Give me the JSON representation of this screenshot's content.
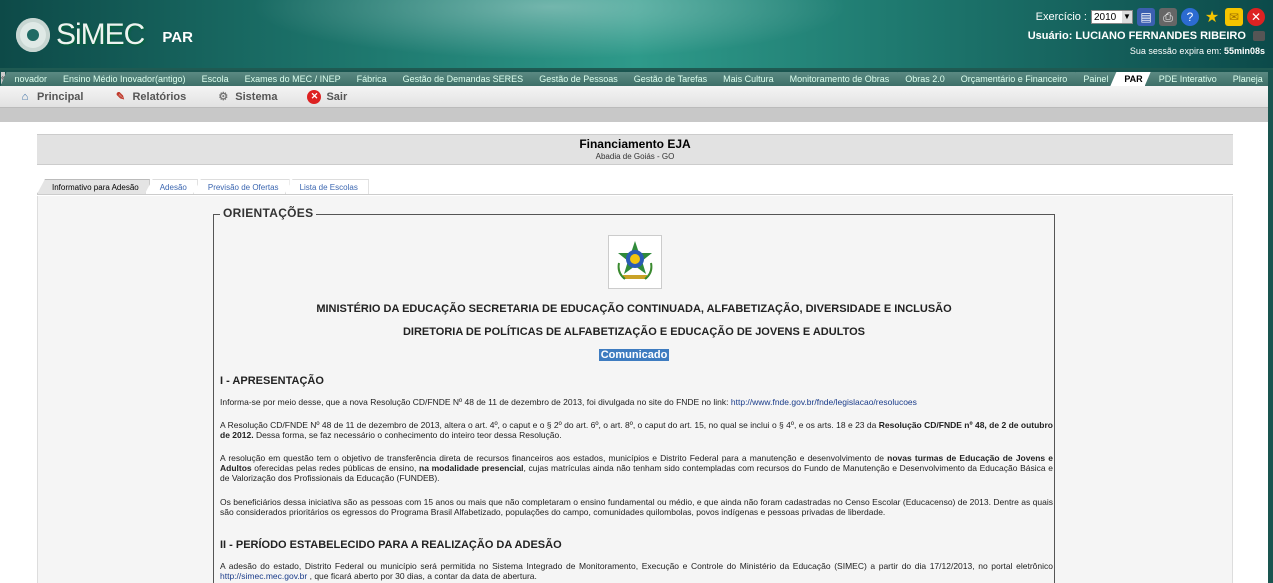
{
  "header": {
    "brand": "SiMEC",
    "module": "PAR",
    "exercise_label": "Exercício :",
    "exercise_year": "2010",
    "user_label": "Usuário:",
    "user_name": "LUCIANO FERNANDES RIBEIRO",
    "session_text": "Sua sessão expira em:",
    "session_time": "55min08s",
    "icons": [
      "chart-icon",
      "printer-icon",
      "help-icon",
      "star-icon",
      "mail-icon",
      "close-icon"
    ]
  },
  "module_tabs": {
    "items": [
      "novador",
      "Ensino Médio Inovador(antigo)",
      "Escola",
      "Exames do MEC / INEP",
      "Fábrica",
      "Gestão de Demandas SERES",
      "Gestão de Pessoas",
      "Gestão de Tarefas",
      "Mais Cultura",
      "Monitoramento de Obras",
      "Obras 2.0",
      "Orçamentário e Financeiro",
      "Painel",
      "PAR",
      "PDE Interativo",
      "Planeja"
    ],
    "active": "PAR"
  },
  "menu": {
    "items": [
      {
        "label": "Principal",
        "icon": "home-icon"
      },
      {
        "label": "Relatórios",
        "icon": "report-icon"
      },
      {
        "label": "Sistema",
        "icon": "settings-icon"
      },
      {
        "label": "Sair",
        "icon": "exit-icon"
      }
    ]
  },
  "page": {
    "title": "Financiamento EJA",
    "subtitle": "Abadia de Goiás - GO"
  },
  "tabs": [
    "Informativo para Adesão",
    "Adesão",
    "Previsão de Ofertas",
    "Lista de Escolas"
  ],
  "orientacoes": {
    "legend": "ORIENTAÇÕES",
    "heading1": "MINISTÉRIO DA EDUCAÇÃO SECRETARIA DE EDUCAÇÃO CONTINUADA, ALFABETIZAÇÃO, DIVERSIDADE E INCLUSÃO",
    "heading2": "DIRETORIA DE POLÍTICAS DE ALFABETIZAÇÃO E EDUCAÇÃO DE JOVENS E ADULTOS",
    "comunicado": "Comunicado",
    "section1_title": "I - APRESENTAÇÃO",
    "p1_text": "Informa-se por meio desse, que a nova Resolução CD/FNDE Nº 48 de 11 de dezembro de 2013, foi divulgada no site do FNDE no link:",
    "p1_link": "http://www.fnde.gov.br/fnde/legislacao/resolucoes",
    "p2_text": "A Resolução CD/FNDE Nº 48 de 11 de dezembro de 2013, altera o art. 4º, o caput e o § 2º do art. 6º, o art. 8º, o caput do art. 15, no qual se inclui o § 4º, e os arts. 18 e 23 da",
    "p2_bold": "Resolução CD/FNDE nº 48, de 2 de outubro de 2012.",
    "p2_tail": "Dessa forma, se faz necessário o conhecimento do inteiro teor dessa Resolução.",
    "p3_a": "A resolução em questão tem o objetivo de transferência direta de recursos financeiros aos estados, municípios e Distrito Federal para a manutenção e desenvolvimento de",
    "p3_b": "novas turmas de Educação de Jovens e Adultos",
    "p3_c": "oferecidas pelas redes públicas de ensino,",
    "p3_d": "na modalidade presencial",
    "p3_e": ", cujas matrículas ainda não tenham sido contempladas com recursos do Fundo de Manutenção e Desenvolvimento da Educação Básica e de Valorização dos Profissionais da Educação (FUNDEB).",
    "p4_text": "Os beneficiários dessa iniciativa são as pessoas com 15 anos ou mais que não completaram o ensino fundamental ou médio, e que ainda não foram cadastradas no Censo Escolar (Educacenso) de 2013. Dentre as quais são considerados prioritários os egressos do Programa Brasil Alfabetizado, populações do campo, comunidades quilombolas, povos indígenas e pessoas privadas de liberdade.",
    "section2_title": "II - PERÍODO ESTABELECIDO PARA A REALIZAÇÃO DA ADESÃO",
    "p5_text": "A adesão do estado, Distrito Federal ou município será permitida no Sistema Integrado de Monitoramento, Execução e Controle do Ministério da Educação (SIMEC) a partir do dia 17/12/2013, no portal eletrônico",
    "p5_link": "http://simec.mec.gov.br",
    "p5_tail": ", que ficará aberto por 30 dias, a contar da data de abertura."
  }
}
